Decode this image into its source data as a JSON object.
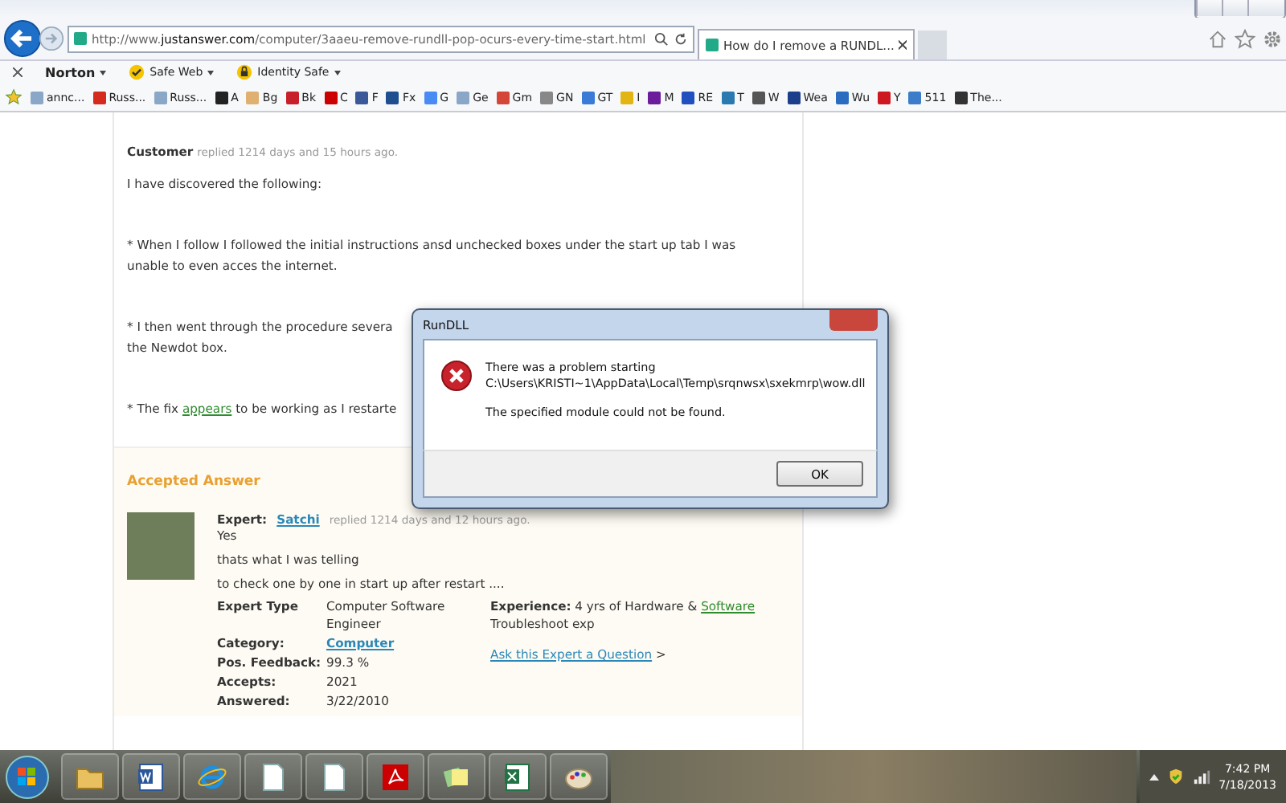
{
  "browser": {
    "address": "http://www.**justanswer.com**/computer/3aaeu-remove-rundll-pop-ocurs-every-time-start.html",
    "tabs": [
      {
        "title": "How do I remove a RUNDL...",
        "selected": true
      }
    ]
  },
  "norton_toolbar": [
    {
      "label": "Norton",
      "kind": "brand"
    },
    {
      "label": "Safe Web",
      "kind": "check"
    },
    {
      "label": "Identity Safe",
      "kind": "lock"
    }
  ],
  "favorites": [
    {
      "label": "annc...",
      "color": "#8aa7c8"
    },
    {
      "label": "Russ...",
      "color": "#d52b1e"
    },
    {
      "label": "Russ...",
      "color": "#8aa7c8"
    },
    {
      "label": "A",
      "color": "#222222"
    },
    {
      "label": "Bg",
      "color": "#e0b070"
    },
    {
      "label": "Bk",
      "color": "#c8202a"
    },
    {
      "label": "C",
      "color": "#cc0000"
    },
    {
      "label": "F",
      "color": "#3b5998"
    },
    {
      "label": "Fx",
      "color": "#1f4f8f"
    },
    {
      "label": "G",
      "color": "#4a8af4"
    },
    {
      "label": "Ge",
      "color": "#8aa7c8"
    },
    {
      "label": "Gm",
      "color": "#d44638"
    },
    {
      "label": "GN",
      "color": "#888888"
    },
    {
      "label": "GT",
      "color": "#3a7bd5"
    },
    {
      "label": "I",
      "color": "#e3b512"
    },
    {
      "label": "M",
      "color": "#6b1d9b"
    },
    {
      "label": "RE",
      "color": "#2050c0"
    },
    {
      "label": "T",
      "color": "#2a7ab0"
    },
    {
      "label": "W",
      "color": "#555555"
    },
    {
      "label": "Wea",
      "color": "#1b3f8b"
    },
    {
      "label": "Wu",
      "color": "#2a6cc0"
    },
    {
      "label": "Y",
      "color": "#cc181e"
    },
    {
      "label": "511",
      "color": "#3d7cc9"
    },
    {
      "label": "The...",
      "color": "#333333"
    }
  ],
  "post": {
    "author": "Customer",
    "meta": "replied 1214 days and 15 hours ago.",
    "paragraphs": [
      {
        "kind": "text",
        "lines": [
          "I have discovered the following:"
        ]
      },
      {
        "kind": "text",
        "lines": [
          "* When I follow I followed the initial instructions ansd unchecked boxes under the start up tab I was",
          "unable to even acces the internet."
        ]
      },
      {
        "kind": "text",
        "lines": [
          "* I then went through the procedure severa",
          "the Newdot box."
        ]
      },
      {
        "kind": "link",
        "before": "* The fix ",
        "link": "appears",
        "after": " to be working as I restarte"
      }
    ]
  },
  "answer": {
    "heading": "Accepted Answer",
    "expert_label": "Expert:",
    "expert_name": "Satchi",
    "meta": "replied 1214 days and 12 hours ago.",
    "lines": [
      "Yes",
      "thats what I was telling",
      "to check one by one in start up after restart ...."
    ],
    "details": [
      {
        "label": "Expert Type",
        "value": "Computer Software Engineer",
        "kind": "text"
      },
      {
        "label": "Category:",
        "value": "Computer",
        "kind": "link"
      },
      {
        "label": "Pos. Feedback:",
        "value": "99.3 %",
        "kind": "text"
      },
      {
        "label": "Accepts:",
        "value": "2021",
        "kind": "text"
      },
      {
        "label": "Answered:",
        "value": "3/22/2010",
        "kind": "text"
      }
    ],
    "experience": {
      "label": "Experience:",
      "before": "4 yrs of Hardware &",
      "link": "Software",
      "after": "Troubleshoot exp"
    },
    "ask": {
      "link": "Ask this Expert a Question",
      "after": ">"
    }
  },
  "dialog": {
    "title": "RunDLL",
    "message": [
      "There was a problem starting",
      "C:\\Users\\KRISTI~1\\AppData\\Local\\Temp\\srqnwsx\\sxekmrp\\wow.dll"
    ],
    "detail": "The specified module could not be found.",
    "button": "OK"
  },
  "taskbar": {
    "apps": [
      {
        "kind": "folder"
      },
      {
        "kind": "word"
      },
      {
        "kind": "browser"
      },
      {
        "kind": "document"
      },
      {
        "kind": "document"
      },
      {
        "kind": "pdf"
      },
      {
        "kind": "notes"
      },
      {
        "kind": "excel"
      },
      {
        "kind": "paint"
      }
    ],
    "time": "7:42 PM",
    "date": "7/18/2013"
  }
}
